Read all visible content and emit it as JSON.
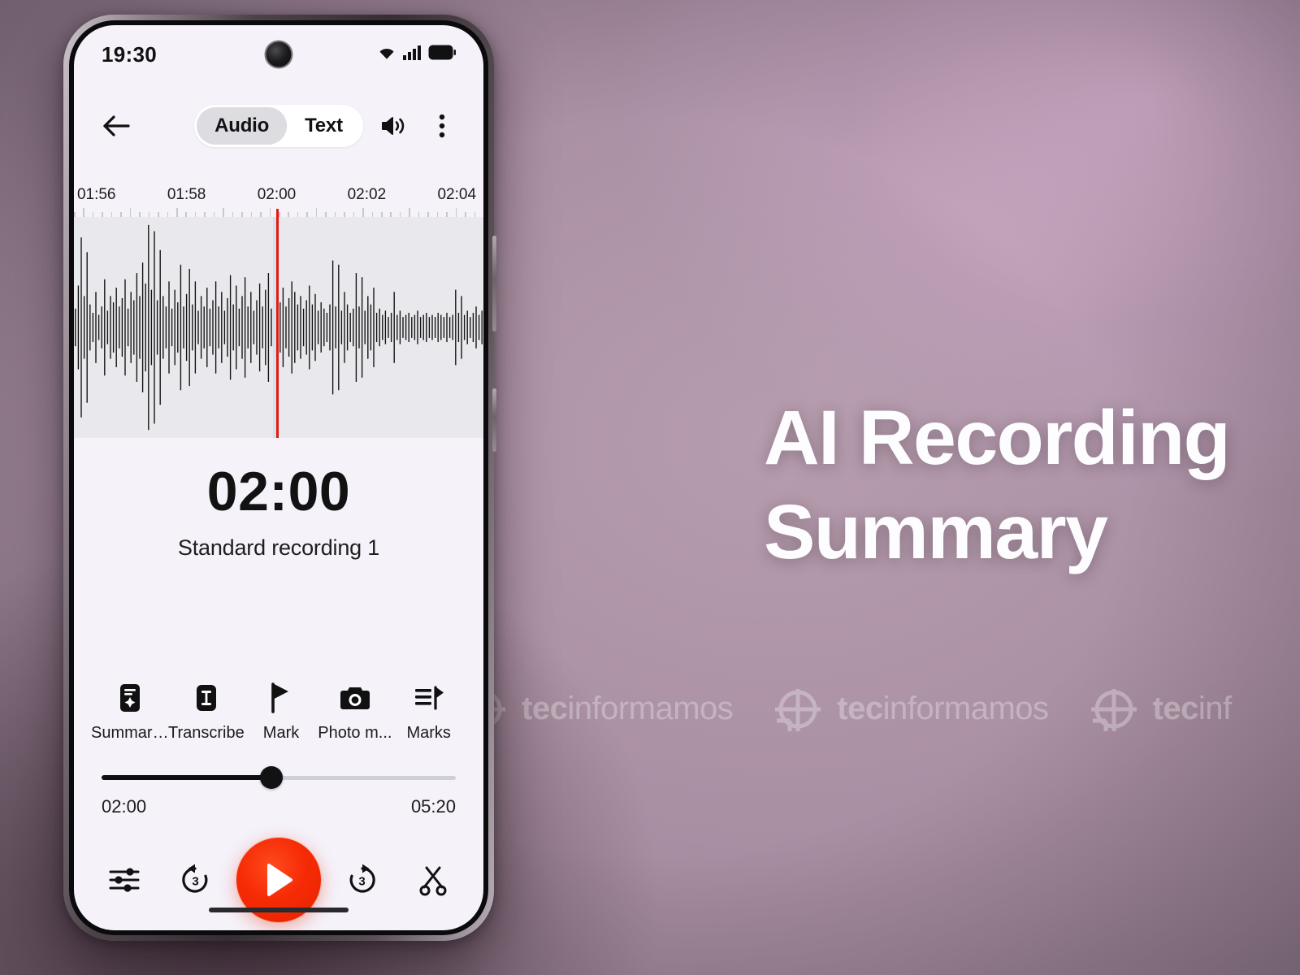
{
  "background": {
    "accent_purple": "#b49cae",
    "accent_pink": "#c8abc4"
  },
  "headline": {
    "line1": "AI Recording",
    "line2": "Summary",
    "color": "#fdfcff"
  },
  "watermark": {
    "bold": "tec",
    "light": "informamos",
    "truncated_bold": "tec",
    "truncated_light": "inf"
  },
  "phone": {
    "statusbar": {
      "clock": "19:30",
      "icons": [
        "wifi-icon",
        "cellular-signal-icon",
        "battery-icon"
      ]
    },
    "topbar": {
      "back_icon": "arrow-left-icon",
      "segments": [
        {
          "label": "Audio",
          "selected": true
        },
        {
          "label": "Text",
          "selected": false
        }
      ],
      "speaker_icon": "speaker-volume-icon",
      "overflow_icon": "more-vertical-icon"
    },
    "ruler": {
      "labels": [
        "01:56",
        "01:58",
        "02:00",
        "02:02",
        "02:04"
      ],
      "label_positions_pct": [
        5.5,
        27.5,
        49.5,
        71.5,
        93.5
      ],
      "playhead_time": "02:00",
      "playhead_pct": 49.5,
      "playhead_color": "#e8180f"
    },
    "waveform": {
      "background": "#e9e9ed",
      "bar_color": "#111111",
      "amplitudes": [
        0.18,
        0.4,
        0.86,
        0.3,
        0.72,
        0.22,
        0.14,
        0.34,
        0.12,
        0.2,
        0.46,
        0.16,
        0.3,
        0.24,
        0.38,
        0.2,
        0.28,
        0.46,
        0.18,
        0.34,
        0.26,
        0.52,
        0.3,
        0.62,
        0.42,
        0.98,
        0.36,
        0.92,
        0.26,
        0.74,
        0.3,
        0.2,
        0.44,
        0.18,
        0.36,
        0.24,
        0.6,
        0.2,
        0.32,
        0.56,
        0.22,
        0.44,
        0.16,
        0.3,
        0.2,
        0.38,
        0.18,
        0.26,
        0.44,
        0.2,
        0.34,
        0.16,
        0.28,
        0.5,
        0.22,
        0.4,
        0.18,
        0.3,
        0.48,
        0.2,
        0.34,
        0.16,
        0.26,
        0.42,
        0.2,
        0.36,
        0.52,
        0.18,
        0.3,
        0.46,
        0.24,
        0.38,
        0.2,
        0.28,
        0.44,
        0.34,
        0.22,
        0.3,
        0.18,
        0.26,
        0.4,
        0.22,
        0.32,
        0.16,
        0.24,
        0.18,
        0.14,
        0.22,
        0.64,
        0.2,
        0.6,
        0.16,
        0.34,
        0.22,
        0.14,
        0.18,
        0.52,
        0.2,
        0.48,
        0.16,
        0.3,
        0.22,
        0.38,
        0.14,
        0.18,
        0.12,
        0.16,
        0.1,
        0.14,
        0.34,
        0.12,
        0.16,
        0.1,
        0.12,
        0.14,
        0.1,
        0.12,
        0.16,
        0.1,
        0.12,
        0.14,
        0.1,
        0.12,
        0.1,
        0.14,
        0.12,
        0.1,
        0.14,
        0.1,
        0.12,
        0.36,
        0.14,
        0.3,
        0.12,
        0.16,
        0.1,
        0.14,
        0.2,
        0.12,
        0.16
      ]
    },
    "stamp": {
      "time": "02:00",
      "recording_name": "Standard recording 1"
    },
    "actions": [
      {
        "label": "Summari...",
        "icon": "summarize-icon"
      },
      {
        "label": "Transcribe",
        "icon": "transcribe-text-icon"
      },
      {
        "label": "Mark",
        "icon": "flag-icon"
      },
      {
        "label": "Photo m...",
        "icon": "camera-icon"
      },
      {
        "label": "Marks",
        "icon": "marks-list-icon"
      }
    ],
    "slider": {
      "current": "02:00",
      "total": "05:20",
      "progress_pct": 48
    },
    "transport": {
      "equalizer_icon": "equalizer-sliders-icon",
      "rewind_label": "3",
      "rewind_icon": "replay-3-icon",
      "play_icon": "play-icon",
      "play_color": "#f62b05",
      "forward_label": "3",
      "forward_icon": "forward-3-icon",
      "trim_icon": "scissors-icon"
    }
  }
}
